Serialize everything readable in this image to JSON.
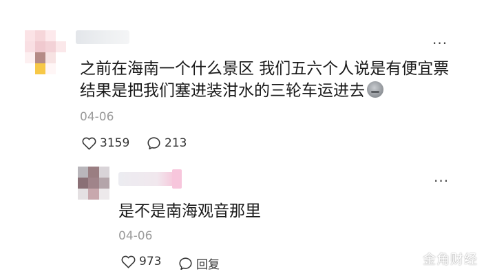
{
  "comment": {
    "avatar_icon": "pixelated-avatar-icon",
    "username": "",
    "text_line1": "之前在海南一个什么景区 我们五六个人说是有便宜票",
    "text_line2": "结果是把我们塞进装泔水的三轮车运进去",
    "emoji_icon": "sad-face-emoji-icon",
    "date": "04-06",
    "likes": "3159",
    "comments": "213",
    "more_icon": "more-dots-icon"
  },
  "reply": {
    "avatar_icon": "pixelated-avatar-icon",
    "username": "",
    "text": "是不是南海观音那里",
    "date": "04-06",
    "likes": "973",
    "reply_label": "回复",
    "more_icon": "more-dots-icon"
  },
  "watermark": "金角财经",
  "colors": {
    "text": "#1a1a1a",
    "meta": "#9a9a9a",
    "background": "#ffffff"
  }
}
